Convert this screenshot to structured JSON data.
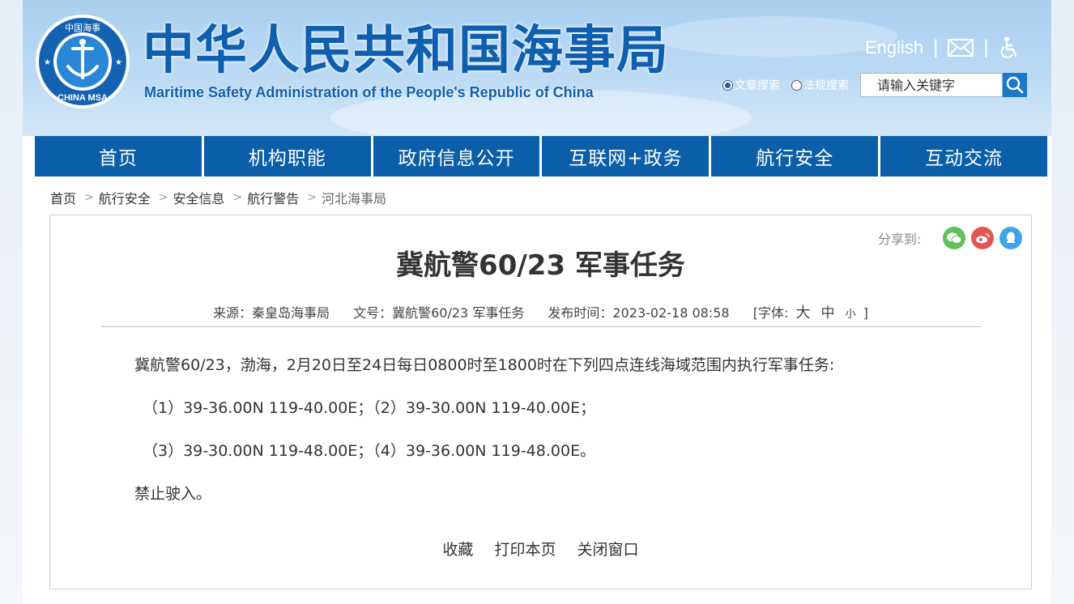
{
  "header": {
    "title": "中华人民共和国海事局",
    "subtitle": "Maritime Safety Administration of the People's Republic of China",
    "logo_top_text": "中国海事",
    "logo_bottom_text": "CHINA MSA",
    "english_link": "English",
    "search_options": [
      "文章搜索",
      "法规搜索"
    ],
    "search_selected": "文章搜索",
    "search_placeholder": "请输入关键字"
  },
  "nav": [
    "首页",
    "机构职能",
    "政府信息公开",
    "互联网+政务",
    "航行安全",
    "互动交流"
  ],
  "breadcrumb": [
    "首页",
    "航行安全",
    "安全信息",
    "航行警告",
    "河北海事局"
  ],
  "article": {
    "share_label": "分享到:",
    "title": "冀航警60/23 军事任务",
    "meta": {
      "source": "来源：秦皇岛海事局",
      "doc_no": "文号：冀航警60/23 军事任务",
      "published": "发布时间：2023-02-18 08:58",
      "font_size_label": "[字体:",
      "font_sizes": [
        "大",
        "中",
        "小"
      ],
      "font_size_close": "]"
    },
    "paragraphs": [
      "冀航警60/23，渤海，2月20日至24日每日0800时至1800时在下列四点连线海域范围内执行军事任务:",
      "（1）39-36.00N 119-40.00E；（2）39-30.00N 119-40.00E；",
      "（3）39-30.00N 119-48.00E；（4）39-36.00N 119-48.00E。",
      "禁止驶入。"
    ],
    "actions": [
      "收藏",
      "打印本页",
      "关闭窗口"
    ]
  },
  "colors": {
    "nav_bg": "#0b5ea8",
    "title_blue": "#0f5fb0",
    "wechat": "#5fc15a",
    "weibo": "#e5554f",
    "qq": "#3fa4ea"
  },
  "icons": [
    "mail-icon",
    "accessibility-icon",
    "search-icon",
    "wechat-icon",
    "weibo-icon",
    "qq-icon"
  ]
}
